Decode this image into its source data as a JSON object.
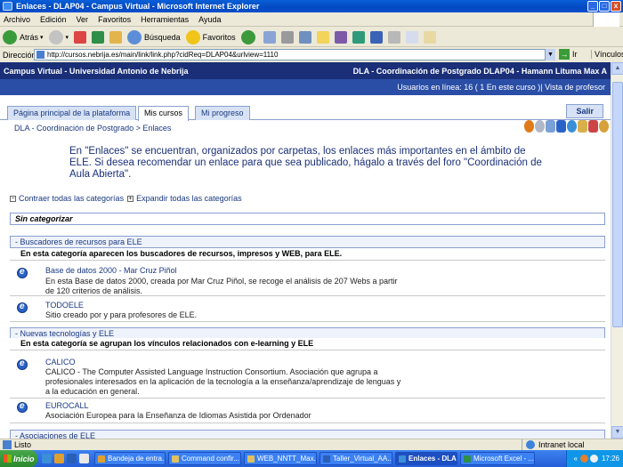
{
  "window": {
    "title": "Enlaces - DLAP04 - Campus Virtual - Microsoft Internet Explorer"
  },
  "menu": [
    "Archivo",
    "Edición",
    "Ver",
    "Favoritos",
    "Herramientas",
    "Ayuda"
  ],
  "toolbar": {
    "back_label": "Atrás",
    "search_label": "Búsqueda",
    "favorites_label": "Favoritos"
  },
  "address": {
    "label": "Dirección",
    "url": "http://cursos.nebrija.es/main/link/link.php?cidReq=DLAP04&urlview=1110",
    "go_label": "Ir",
    "links_label": "Vínculos"
  },
  "campus": {
    "left": "Campus Virtual - Universidad Antonio de Nebrija",
    "right": "DLA - Coordinación de Postgrado DLAP04 - Hamann Lituma Max A",
    "online": "Usuarios en línea:  16  ( 1 En este curso )| Vista de profesor"
  },
  "tabs": [
    {
      "label": "Página principal de la plataforma"
    },
    {
      "label": "Mis cursos"
    },
    {
      "label": "Mi progreso"
    }
  ],
  "salir_label": "Salir",
  "breadcrumb": {
    "course": "DLA - Coordinación de Postgrado",
    "sep": " > ",
    "current": "Enlaces"
  },
  "intro_text": "En \"Enlaces\" se encuentran, organizados por carpetas, los enlaces más importantes en el ámbito de ELE. Si desea recomendar un enlace para que sea publicado, hágalo a través del foro \"Coordinación de Aula Abierta\".",
  "controls": {
    "collapse": "Contraer todas las categorías",
    "expand": "Expandir todas las categorías"
  },
  "uncategorized": "Sin categorizar",
  "categories": [
    {
      "title": "- Buscadores de recursos para ELE",
      "description": "En esta categoría aparecen los buscadores de recursos, impresos y WEB, para ELE.",
      "links": [
        {
          "title": "Base de datos 2000 - Mar Cruz Piñol",
          "description": "En esta Base de datos 2000, creada por Mar Cruz Piñol, se recoge el análisis de 207 Webs a partir de 120 criterios de análisis."
        },
        {
          "title": "TODOELE",
          "description": "Sitio creado por y para profesores de ELE."
        }
      ]
    },
    {
      "title": "- Nuevas tecnologías y ELE",
      "description": "En esta categoría se agrupan los vínculos relacionados con e-learning y ELE",
      "links": [
        {
          "title": "CALICO",
          "description": "CALICO - The Computer Assisted Language Instruction Consortium. Asociación que agrupa a profesionales interesados en la aplicación de la tecnología a la enseñanza/aprendizaje de lenguas y a la educación en general."
        },
        {
          "title": "EUROCALL",
          "description": "Asociación Europea para la Enseñanza de Idiomas Asistida por Ordenador"
        }
      ]
    },
    {
      "title": "- Asociaciones de ELE"
    }
  ],
  "status": {
    "text": "Listo",
    "zone": "Intranet local"
  },
  "taskbar": {
    "start": "Inicio",
    "tasks": [
      {
        "label": "Bandeja de entra..."
      },
      {
        "label": "Command confir..."
      },
      {
        "label": "WEB_NNTT_Max..."
      },
      {
        "label": "Taller_Virtual_AA..."
      },
      {
        "label": "Enlaces - DLAP..."
      },
      {
        "label": "Microsoft Excel - ..."
      }
    ],
    "clock": "17:26"
  }
}
